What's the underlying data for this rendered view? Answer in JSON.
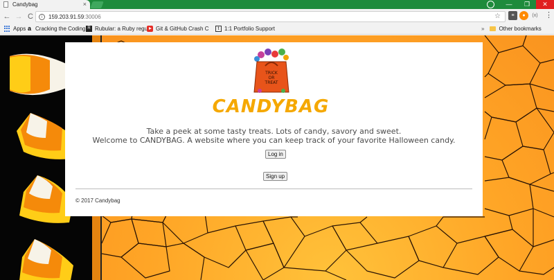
{
  "browser": {
    "tab_title": "Candybag",
    "tab_close": "×",
    "url_host": "159.203.91.59",
    "url_port": ":30006",
    "nav": {
      "back": "←",
      "forward": "→",
      "reload": "C"
    },
    "window_controls": {
      "minimize": "—",
      "maximize": "❐",
      "close": "✕"
    },
    "extensions": [
      "≡",
      "●",
      "(x)"
    ],
    "menu": "⋮"
  },
  "bookmarks": {
    "items": [
      {
        "label": "Apps",
        "icon": "apps-grid-icon"
      },
      {
        "label": "Cracking the Coding",
        "icon": "amazon-icon"
      },
      {
        "label": "Rubular: a Ruby regu",
        "icon": "rubular-icon"
      },
      {
        "label": "Git & GitHub Crash C",
        "icon": "youtube-icon"
      },
      {
        "label": "1:1 Portfolio Support",
        "icon": "t-icon"
      }
    ],
    "overflow": "»",
    "other": "Other bookmarks"
  },
  "page": {
    "logo_text": "CANDYBAG",
    "bag_text_1": "TRICK",
    "bag_text_2": "OR",
    "bag_text_3": "TREAT",
    "intro_line1": "Take a peek at some tasty treats. Lots of candy, savory and sweet.",
    "intro_line2": "Welcome to CANDYBAG. A website where you can keep track of your favorite Halloween candy.",
    "login_label": "Log in",
    "signup_label": "Sign up",
    "footer": "© 2017 Candybag"
  },
  "colors": {
    "chrome_accent": "#1e8b3c",
    "logo": "#f5a800",
    "background_orange": "#ffa526"
  }
}
